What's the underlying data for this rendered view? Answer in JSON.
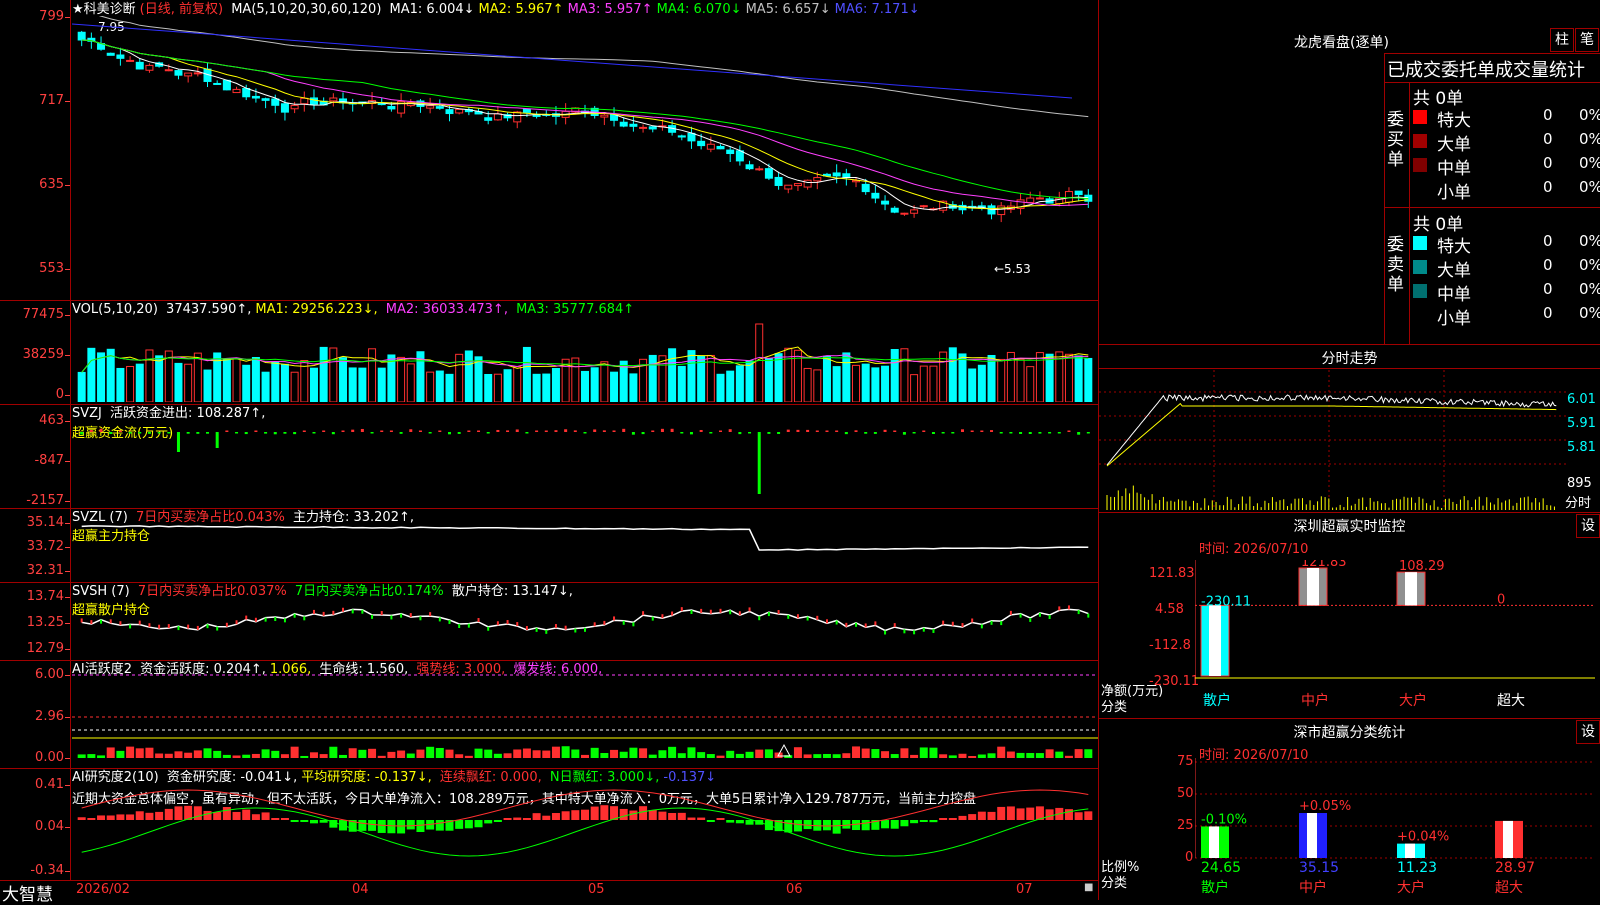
{
  "main": {
    "stock_name": "★科美诊断",
    "period": "(日线, 前复权)",
    "ma_label": "MA(5,10,20,30,60,120)",
    "ma": [
      {
        "label": "MA1:",
        "value": "6.004",
        "arrow": "↓",
        "color": "#ffffff"
      },
      {
        "label": "MA2:",
        "value": "5.967",
        "arrow": "↑",
        "color": "#ffff00"
      },
      {
        "label": "MA3:",
        "value": "5.957",
        "arrow": "↑",
        "color": "#ff40ff"
      },
      {
        "label": "MA4:",
        "value": "6.070",
        "arrow": "↓",
        "color": "#00ff00"
      },
      {
        "label": "MA5:",
        "value": "6.657",
        "arrow": "↓",
        "color": "#c0c0c0"
      },
      {
        "label": "MA6:",
        "value": "7.171",
        "arrow": "↓",
        "color": "#5050ff"
      }
    ],
    "y_ticks": [
      "799",
      "717",
      "635",
      "553"
    ],
    "high_label": "7.95",
    "low_label": "←5.53"
  },
  "vol": {
    "title": "VOL(5,10,20)",
    "value": "37437.590↑,",
    "ma1": "MA1: 29256.223↓,",
    "ma2": "MA2: 36033.473↑,",
    "ma3": "MA3: 35777.684↑",
    "y_ticks": [
      "77475",
      "38259",
      "0"
    ]
  },
  "svzj": {
    "title": "SVZJ",
    "text": "活跃资金进出: 108.287↑,",
    "sub": "超赢资金流(万元)",
    "y_ticks": [
      "463",
      "-847",
      "-2157"
    ]
  },
  "svzl": {
    "title": "SVZL (7)",
    "t1": "7日内买卖净占比0.043%",
    "t2": "主力持仓: 33.202↑,",
    "sub": "超赢主力持仓",
    "y_ticks": [
      "35.14",
      "33.72",
      "32.31"
    ]
  },
  "svsh": {
    "title": "SVSH (7)",
    "t1": "7日内买卖净占比0.037%",
    "t2": "7日内买卖净占比0.174%",
    "t3": "散户持仓: 13.147↓,",
    "sub": "超赢散户持仓",
    "y_ticks": [
      "13.74",
      "13.25",
      "12.79"
    ]
  },
  "ai1": {
    "title": "AI活跃度2",
    "t1": "资金活跃度: 0.204↑,",
    "t2": "1.066,",
    "t3": "生命线: 1.560,",
    "t4": "强势线: 3.000,",
    "t5": "爆发线: 6.000,",
    "y_ticks": [
      "6.00",
      "2.96",
      "0.00"
    ]
  },
  "ai2": {
    "title": "AI研究度2(10)",
    "t1": "资金研究度: -0.041↓,",
    "t2": "平均研究度: -0.137↓,",
    "t3": "连续飘红: 0.000,",
    "t4": "N日飘红: 3.000↓,",
    "t5": "-0.137↓",
    "comment": "近期大资金总体偏空，虽有异动，但不太活跃，今日大单净流入：108.289万元，其中特大单净流入：0万元，大单5日累计净入129.787万元，当前主力控盘",
    "y_ticks": [
      "0.41",
      "0.04",
      "-0.34"
    ]
  },
  "footer": {
    "brand": "大智慧",
    "dates": [
      "2026/02",
      "04",
      "05",
      "06",
      "07"
    ]
  },
  "right": {
    "lhb_title": "龙虎看盘(逐单)",
    "btn_bar": "柱",
    "btn_pen": "笔",
    "stat_header": "已成交委托单成交量统计",
    "buy_side": "委买单",
    "sell_side": "委卖单",
    "buy_total": "共 0单",
    "sell_total": "共 0单",
    "rows": [
      {
        "name": "特大",
        "count": "0",
        "pct": "0%"
      },
      {
        "name": "大单",
        "count": "0",
        "pct": "0%"
      },
      {
        "name": "中单",
        "count": "0",
        "pct": "0%"
      },
      {
        "name": "小单",
        "count": "0",
        "pct": "0%"
      }
    ],
    "buy_colors": [
      "#ff0000",
      "#a00000",
      "#800000",
      ""
    ],
    "sell_colors": [
      "#00ffff",
      "#008b8b",
      "#007070",
      ""
    ],
    "fs_title": "分时走势",
    "fs_ticks": [
      "6.01",
      "5.91",
      "5.81"
    ],
    "fs_vol": "895",
    "fs_label": "分时",
    "sz_title": "深圳超赢实时监控",
    "sz_btn": "设",
    "sz_time": "时间: 2026/07/10",
    "sz_ticks": [
      "121.83",
      "4.58",
      "-112.8",
      "-230.11"
    ],
    "sz_ylabel": "净额(万元)",
    "sz_xlabel": "分类",
    "sz_values": [
      {
        "cat": "散户",
        "value": "-230.11"
      },
      {
        "cat": "中户",
        "value": "121.83"
      },
      {
        "cat": "大户",
        "value": "108.29"
      },
      {
        "cat": "超大",
        "value": "0"
      }
    ],
    "ss_title": "深市超赢分类统计",
    "ss_btn": "设",
    "ss_time": "时间: 2026/07/10",
    "ss_ticks": [
      "75",
      "50",
      "25",
      "0"
    ],
    "ss_ylabel": "比例%",
    "ss_xlabel": "分类",
    "ss_values": [
      {
        "cat": "散户",
        "ratio": "24.65",
        "change": "-0.10%"
      },
      {
        "cat": "中户",
        "ratio": "35.15",
        "change": "+0.05%"
      },
      {
        "cat": "大户",
        "ratio": "11.23",
        "change": "+0.04%"
      },
      {
        "cat": "超大",
        "ratio": "28.97",
        "change": ""
      }
    ]
  }
}
